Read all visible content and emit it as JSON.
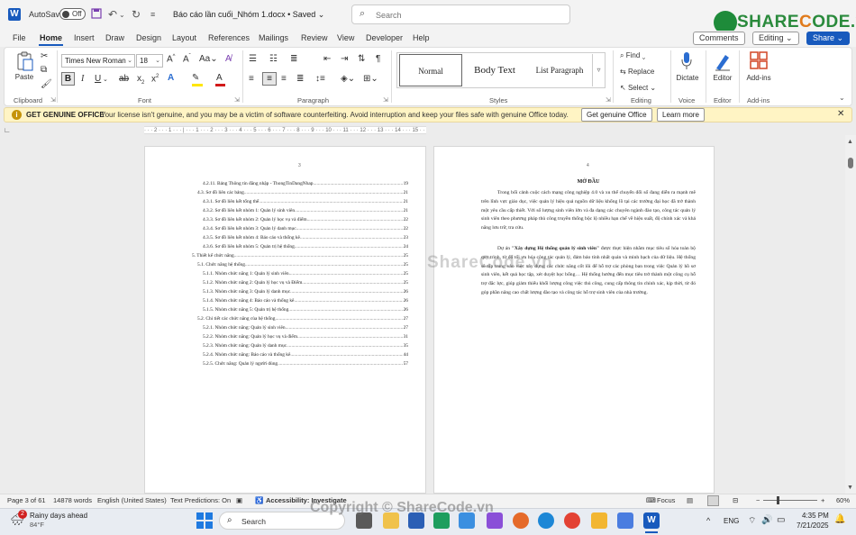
{
  "titlebar": {
    "app_letter": "W",
    "autosave_label": "AutoSave",
    "autosave_state": "Off",
    "doc_title": "Báo cáo lần cuối_Nhóm 1.docx • Saved ⌄",
    "search_placeholder": "Search",
    "brand_prefix": "SHARE",
    "brand_o": "C",
    "brand_suffix": "ODE.vn"
  },
  "menu": {
    "items": [
      "File",
      "Home",
      "Insert",
      "Draw",
      "Design",
      "Layout",
      "References",
      "Mailings",
      "Review",
      "View",
      "Developer",
      "Help"
    ],
    "comments": "Comments",
    "editing": "Editing ⌄",
    "share": "Share ⌄"
  },
  "ribbon": {
    "paste": "Paste",
    "clipboard": "Clipboard",
    "font_name": "Times New Roman",
    "font_size": "18",
    "font": "Font",
    "paragraph": "Paragraph",
    "styles": "Styles",
    "style_items": [
      "Normal",
      "Body Text",
      "List Paragraph"
    ],
    "find": "Find ⌄",
    "replace": "Replace",
    "select": "Select ⌄",
    "editing_group": "Editing",
    "dictate": "Dictate",
    "voice": "Voice",
    "editor": "Editor",
    "editor_group": "Editor",
    "addins": "Add-ins",
    "addins_group": "Add-ins"
  },
  "infobar": {
    "title": "GET GENUINE OFFICE",
    "message": "Your license isn't genuine, and you may be a victim of software counterfeiting. Avoid interruption and keep your files safe with genuine Office today.",
    "btn_genuine": "Get genuine Office",
    "btn_learn": "Learn more"
  },
  "ruler_text": "· · · 2 · · · 1 · · · | · · · 1 · · · 2 · · · 3 · · · 4 · · · 5 · · · 6 · · · 7 · · · 8 · · · 9 · · · 10 · · · 11 · · · 12 · · · 13 · · · 14 · · · 15 · · · | · · ·",
  "page1": {
    "page_number": "3",
    "toc": [
      {
        "text": "4.2.11. Bảng Thông tin đăng nhập - ThongTinDangNhap",
        "page": "19",
        "indent": 2
      },
      {
        "text": "4.3. Sơ đồ liên các bảng",
        "page": "21",
        "indent": 1
      },
      {
        "text": "4.3.1. Sơ đồ liên kết tổng thể",
        "page": "21",
        "indent": 2
      },
      {
        "text": "4.3.2. Sơ đồ liên kết nhóm 1: Quản lý sinh viên",
        "page": "21",
        "indent": 2
      },
      {
        "text": "4.3.3. Sơ đồ liên kết nhóm 2: Quản lý học vụ và điểm",
        "page": "22",
        "indent": 2
      },
      {
        "text": "4.3.4. Sơ đồ liên kết nhóm 3: Quản lý danh mục",
        "page": "22",
        "indent": 2
      },
      {
        "text": "4.3.5. Sơ đồ liên kết nhóm 4: Báo cáo và thống kê",
        "page": "23",
        "indent": 2
      },
      {
        "text": "4.3.6. Sơ đồ liên kết nhóm 5: Quản trị hệ thống",
        "page": "24",
        "indent": 2
      },
      {
        "text": "5. Thiết kế chức năng",
        "page": "25",
        "indent": 0
      },
      {
        "text": "5.1. Chức năng hệ thống",
        "page": "25",
        "indent": 1
      },
      {
        "text": "5.1.1. Nhóm chức năng 1: Quản lý sinh viên",
        "page": "25",
        "indent": 2
      },
      {
        "text": "5.1.2. Nhóm chức năng 2: Quản lý học vụ và Điểm",
        "page": "25",
        "indent": 2
      },
      {
        "text": "5.1.3. Nhóm chức năng 3: Quản lý danh mục",
        "page": "26",
        "indent": 2
      },
      {
        "text": "5.1.4. Nhóm chức năng 4: Báo cáo và thống kê",
        "page": "26",
        "indent": 2
      },
      {
        "text": "5.1.5. Nhóm chức năng 5: Quản trị hệ thống",
        "page": "26",
        "indent": 2
      },
      {
        "text": "5.2. Chi tiết các chức năng của hệ thống",
        "page": "27",
        "indent": 1
      },
      {
        "text": "5.2.1. Nhóm chức năng: Quản lý sinh viên",
        "page": "27",
        "indent": 2
      },
      {
        "text": "5.2.2. Nhóm chức năng: Quản lý học vụ và điểm",
        "page": "31",
        "indent": 2
      },
      {
        "text": "5.2.3. Nhóm chức năng: Quản lý danh mục",
        "page": "35",
        "indent": 2
      },
      {
        "text": "5.2.4. Nhóm chức năng: Báo cáo và thống kê",
        "page": "44",
        "indent": 2
      },
      {
        "text": "5.2.5. Chức năng: Quản lý người dùng",
        "page": "57",
        "indent": 2
      }
    ]
  },
  "page2": {
    "page_number": "4",
    "heading": "MỞ ĐẦU",
    "para1": "Trong bối cảnh cuộc cách mạng công nghiệp 4.0 và xu thế chuyển đổi số đang diễn ra mạnh mẽ trên lĩnh vực giáo dục, việc quản lý hiệu quả nguồn dữ liệu khổng lồ tại các trường đại học đã trở thành một yêu cầu cấp thiết. Với số lượng sinh viên lớn và đa dạng các chuyên ngành đào tạo, công tác quản lý sinh viên theo phương pháp thủ công truyền thống bộc lộ nhiều hạn chế về hiệu suất, độ chính xác và khả năng lưu trữ, tra cứu.",
    "para2_prefix": "Dự án ",
    "para2_bold": "\"Xây dựng Hệ thống quản lý sinh viên\"",
    "para2_rest": " được thực hiện nhằm mục tiêu số hóa toàn bộ quy trình, từ đó tối ưu hóa công tác quản lý, đảm bảo tính nhất quán và minh bạch của dữ liệu. Hệ thống sẽ tập trung vào việc xây dựng các chức năng cốt lõi để hỗ trợ các phòng ban trong việc Quản lý hồ sơ sinh viên, kết quả học tập, xét duyệt học bổng… Hệ thống hướng đến mục tiêu trở thành một công cụ hỗ trợ đắc lực, giúp giảm thiểu khối lượng công việc thủ công, cung cấp thông tin chính xác, kịp thời, từ đó góp phần nâng cao chất lượng đào tạo và công tác hỗ trợ sinh viên của nhà trường."
  },
  "watermarks": {
    "page": "ShareCode.vn",
    "footer": "Copyright © ShareCode.vn"
  },
  "status": {
    "page": "Page 3 of 61",
    "words": "14878 words",
    "language": "English (United States)",
    "predictions": "Text Predictions: On",
    "accessibility": "Accessibility: Investigate",
    "focus": "Focus",
    "zoom": "60%"
  },
  "taskbar": {
    "weather_badge": "2",
    "weather_title": "Rainy days ahead",
    "weather_temp": "84°F",
    "search": "Search",
    "lang": "ENG",
    "time": "4:35 PM",
    "date": "7/21/2025"
  },
  "colors": {
    "accent": "#185abd",
    "infobar": "#fff4c4",
    "brand_green": "#2a8a3c"
  }
}
